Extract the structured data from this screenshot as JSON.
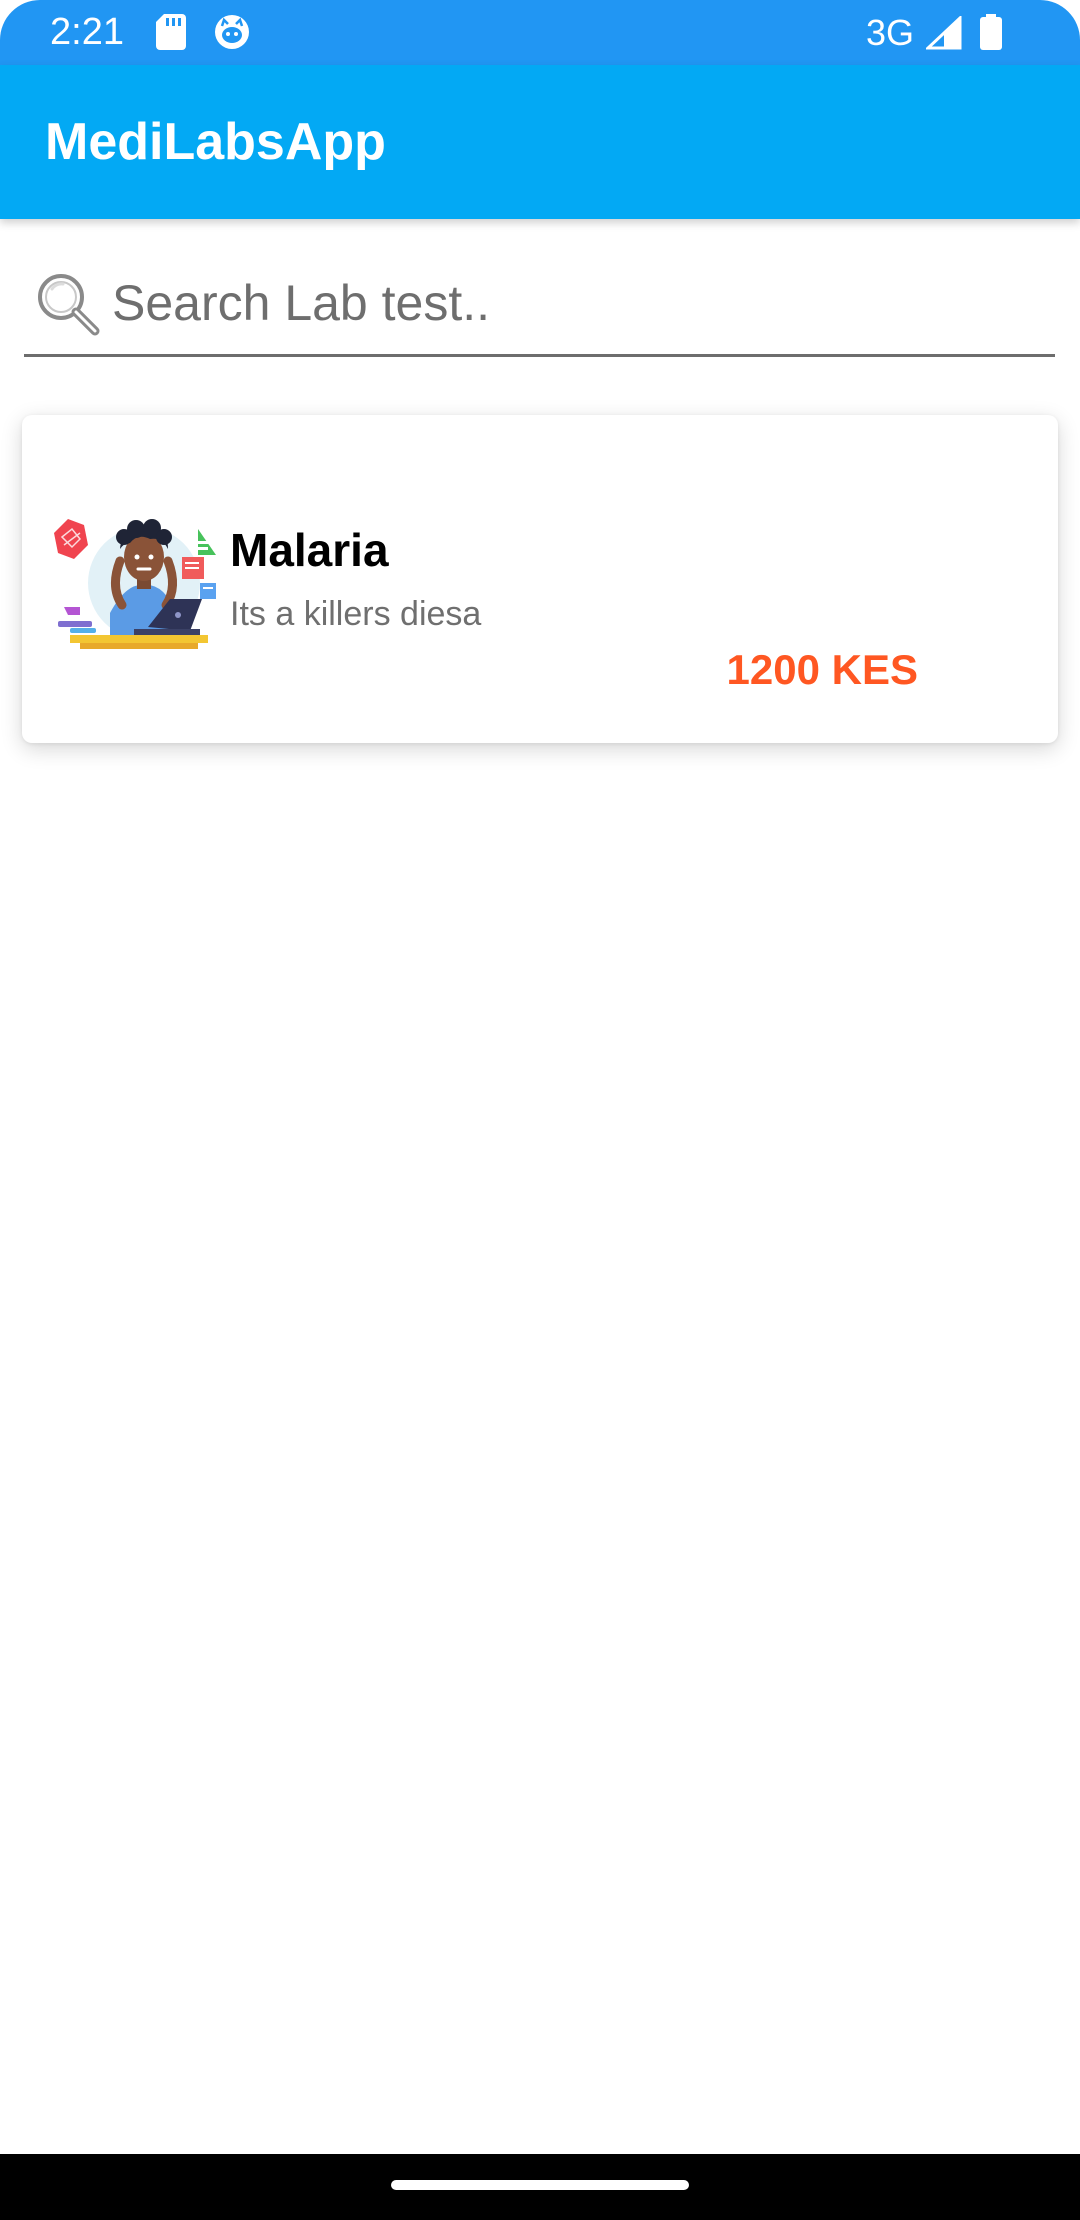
{
  "status_bar": {
    "time": "2:21",
    "network": "3G",
    "icons": [
      "sd-card-icon",
      "cat-face-icon",
      "signal-icon",
      "battery-icon"
    ]
  },
  "app_bar": {
    "title": "MediLabsApp",
    "color": "#03A9F4"
  },
  "search": {
    "placeholder": "Search Lab test..",
    "value": "",
    "icon": "search-icon"
  },
  "lab_tests": [
    {
      "name": "Malaria",
      "description": "Its a killers diesa",
      "price": "1200 KES",
      "image": "stressed-person-illustration"
    }
  ],
  "colors": {
    "status_bar": "#2196F3",
    "price": "#FF5722"
  }
}
